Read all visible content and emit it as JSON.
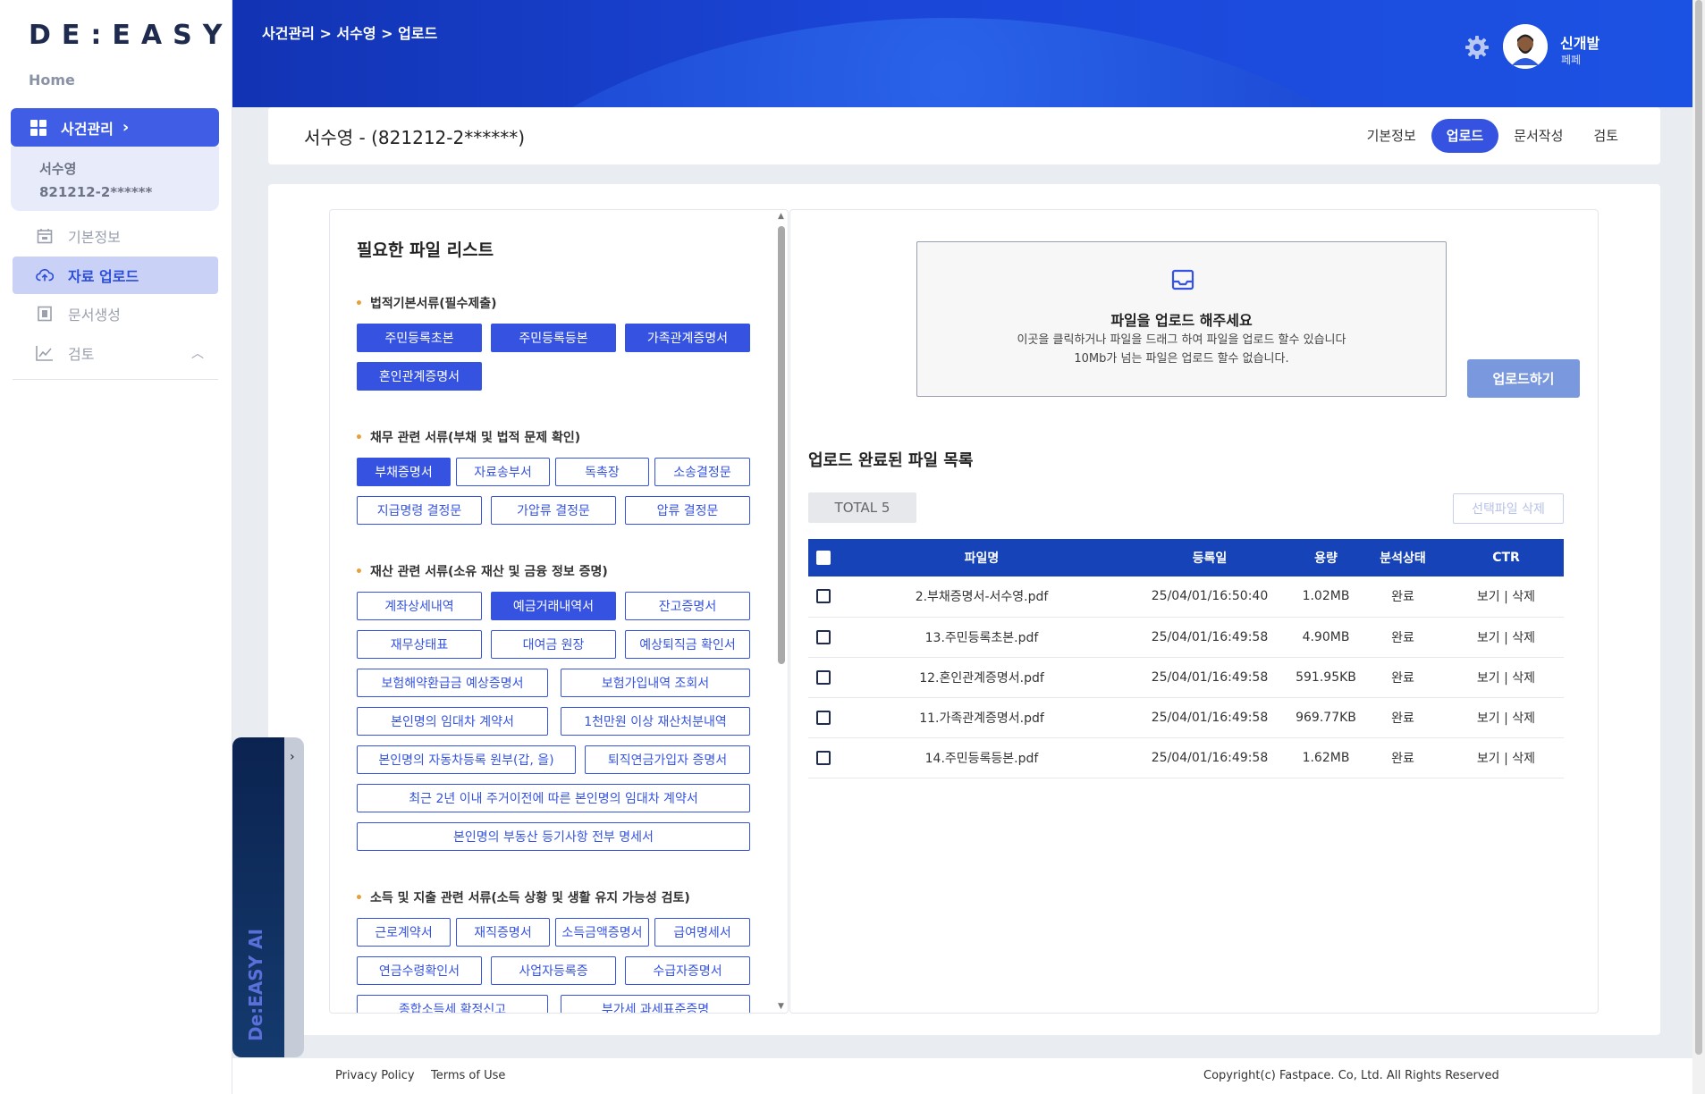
{
  "sidebar": {
    "logo": "DE:EASY",
    "home": "Home",
    "main_item": "사건관리",
    "case_name": "서수영",
    "case_id": "821212-2******",
    "menu": [
      {
        "label": "기본정보",
        "icon": "calendar-icon"
      },
      {
        "label": "자료 업로드",
        "icon": "cloud-upload-icon"
      },
      {
        "label": "문서생성",
        "icon": "document-icon"
      },
      {
        "label": "검토",
        "icon": "chart-line-icon"
      }
    ]
  },
  "header": {
    "breadcrumb": "사건관리 > 서수영 > 업로드",
    "user_name": "신개발",
    "user_sub": "페페"
  },
  "title_bar": {
    "person": "서수영 - (821212-2******)",
    "tabs": [
      "기본정보",
      "업로드",
      "문서작성",
      "검토"
    ],
    "active_tab": "업로드"
  },
  "required_files": {
    "title": "필요한 파일 리스트",
    "sections": [
      {
        "title": "법적기본서류(필수제출)",
        "items": [
          "주민등록초본",
          "주민등록등본",
          "가족관계증명서",
          "혼인관계증명서"
        ]
      },
      {
        "title": "채무 관련 서류(부채 및 법적 문제 확인)",
        "items": [
          "부채증명서",
          "자료송부서",
          "독촉장",
          "소송결정문",
          "지급명령 결정문",
          "가압류 결정문",
          "압류 결정문"
        ]
      },
      {
        "title": "재산 관련 서류(소유 재산 및 금융 정보 증명)",
        "items": [
          "계좌상세내역",
          "예금거래내역서",
          "잔고증명서",
          "재무상태표",
          "대여금 원장",
          "예상퇴직금 확인서",
          "보험해약환급금 예상증명서",
          "보험가입내역 조회서",
          "본인명의 임대차 계약서",
          "1천만원 이상 재산처분내역",
          "본인명의 자동차등록 원부(갑, 을)",
          "퇴직연금가입자 증명서",
          "최근 2년 이내 주거이전에 따른 본인명의 임대차 계약서",
          "본인명의 부동산 등기사항 전부 명세서"
        ]
      },
      {
        "title": "소득 및 지출 관련 서류(소득 상황 및 생활 유지 가능성 검토)",
        "items": [
          "근로계약서",
          "재직증명서",
          "소득금액증명서",
          "급여명세서",
          "연금수령확인서",
          "사업자등록증",
          "수급자증명서",
          "종합소득세 확정신고",
          "부가세 과세표준증명"
        ]
      }
    ]
  },
  "upload": {
    "drop_title": "파일을 업로드 해주세요",
    "drop_line1": "이곳을 클릭하거나 파일을 드래그 하여 파일을 업로드 할수 있습니다",
    "drop_line2": "10Mb가 넘는 파일은 업로드 할수 없습니다.",
    "upload_button": "업로드하기",
    "list_title": "업로드 완료된 파일 목록",
    "total": "TOTAL 5",
    "delete_selected": "선택파일 삭제",
    "columns": [
      "파일명",
      "등록일",
      "용량",
      "분석상태",
      "CTR"
    ],
    "rows": [
      {
        "name": "2.부채증명서-서수영.pdf",
        "date": "25/04/01/16:50:40",
        "size": "1.02MB",
        "status": "완료",
        "ctr": "보기 | 삭제"
      },
      {
        "name": "13.주민등록초본.pdf",
        "date": "25/04/01/16:49:58",
        "size": "4.90MB",
        "status": "완료",
        "ctr": "보기 | 삭제"
      },
      {
        "name": "12.혼인관계증명서.pdf",
        "date": "25/04/01/16:49:58",
        "size": "591.95KB",
        "status": "완료",
        "ctr": "보기 | 삭제"
      },
      {
        "name": "11.가족관계증명서.pdf",
        "date": "25/04/01/16:49:58",
        "size": "969.77KB",
        "status": "완료",
        "ctr": "보기 | 삭제"
      },
      {
        "name": "14.주민등록등본.pdf",
        "date": "25/04/01/16:49:58",
        "size": "1.62MB",
        "status": "완료",
        "ctr": "보기 | 삭제"
      }
    ]
  },
  "ai_tab": {
    "label": "De:EASY AI"
  },
  "footer": {
    "privacy": "Privacy Policy",
    "terms": "Terms of Use",
    "copyright": "Copyright(c) Fastpace. Co, Ltd. All Rights Reserved"
  },
  "colors": {
    "accent": "#3553e0",
    "header": "#1643b7",
    "sidebar_active": "#3f5ee5"
  }
}
